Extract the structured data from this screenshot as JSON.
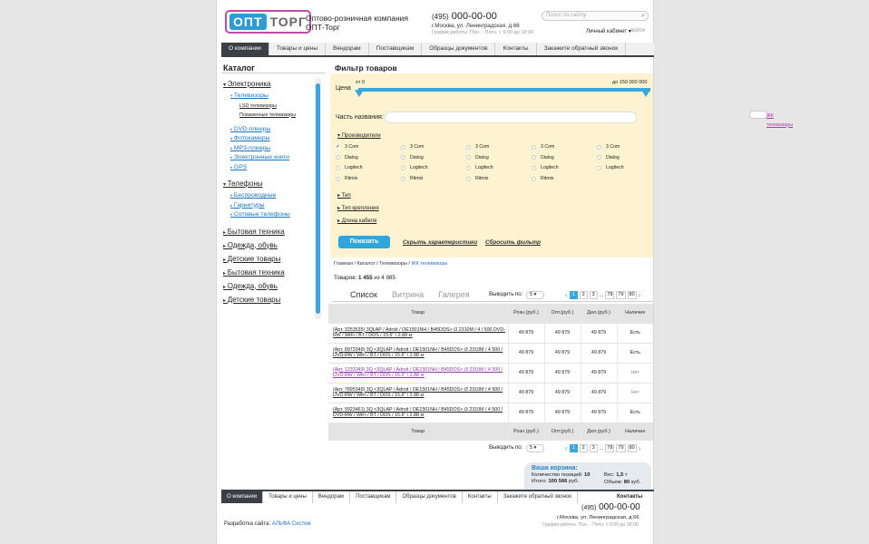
{
  "header": {
    "logo_a": "ОПТ",
    "logo_b": "ТОРГ",
    "company_line1": "Оптово-розничная компания",
    "company_line2": "ОПТ-Торг",
    "phone_code": "(495)",
    "phone_num": "000-00-00",
    "address": "г.Москва, ул. Ленинградская, д.66",
    "hours": "График работы: Пон. - Пятн. с 9:00 до 18:00",
    "search_placeholder": "Поиск по сайту",
    "cabinet": "Личный кабинет ▾",
    "login": "войти"
  },
  "nav": [
    "О компании",
    "Товары и цены",
    "Вендорам",
    "Поставщикам",
    "Образцы документов",
    "Контакты",
    "Закажите обратный звонок"
  ],
  "catalog": {
    "title": "Каталог",
    "items": [
      {
        "level": 1,
        "label": "Электроника",
        "open": true
      },
      {
        "level": 2,
        "label": "Телевизоры",
        "open": true
      },
      {
        "level": 3,
        "label": "LSD телевизоры"
      },
      {
        "level": 3,
        "label": "ЖК телевизоры",
        "selected": true
      },
      {
        "level": 3,
        "label": "Плазменные телевизоры"
      },
      {
        "gap": true
      },
      {
        "level": 2,
        "label": "DVD-плееры"
      },
      {
        "level": 2,
        "label": "Фотокамеры"
      },
      {
        "level": 2,
        "label": "MP3-плееры"
      },
      {
        "level": 2,
        "label": "Электронные книги"
      },
      {
        "level": 2,
        "label": "GPS"
      },
      {
        "gap": true
      },
      {
        "level": 1,
        "label": "Телефоны",
        "open": true
      },
      {
        "level": 2,
        "label": "Беспроводные"
      },
      {
        "level": 2,
        "label": "Гарнитуры"
      },
      {
        "level": 2,
        "label": "Сотовые телефоны"
      },
      {
        "gap": true
      },
      {
        "level": 1,
        "label": "Бытовая техника"
      },
      {
        "level": 1,
        "label": "Одежда, обувь"
      },
      {
        "level": 1,
        "label": "Детские товары"
      },
      {
        "level": 1,
        "label": "Бытовая техника"
      },
      {
        "level": 1,
        "label": "Одежда, обувь"
      },
      {
        "level": 1,
        "label": "Детские товары"
      }
    ]
  },
  "filter": {
    "title": "Фильтр товаров",
    "price_label": "Цена",
    "from": "от 0",
    "to": "до 150 000 000",
    "name_label": "Часть названия:",
    "producers": "Производители",
    "grid": [
      [
        "3 Com",
        "3 Com",
        "3 Com",
        "3 Com",
        "3 Com"
      ],
      [
        "Dialog",
        "Dialog",
        "Dialog",
        "Dialog",
        "Dialog"
      ],
      [
        "Logitech",
        "Logitech",
        "Logitech",
        "Logitech",
        "Logitech"
      ],
      [
        "Ritmix",
        "Ritmix",
        "Ritmix",
        "Ritmix"
      ]
    ],
    "checked_first": true,
    "sec_type": "Тип",
    "sec_mount": "Тип крепления",
    "sec_cable": "Длина кабеля",
    "show": "Показать",
    "hide": "Скрыть характеристики",
    "reset": "Сбросить фильтр"
  },
  "breadcrumbs": {
    "path": "Главная / Каталог / Телевизоры / ",
    "current": "ЖК телевизоры"
  },
  "count": {
    "label": "Товаров:",
    "value": "1 455",
    "of": "из",
    "total": "4 985"
  },
  "tabs": [
    "Список",
    "Витрина",
    "Галерея"
  ],
  "perpage": {
    "label": "Выводить по:",
    "value": "5"
  },
  "pages": [
    "1",
    "2",
    "3",
    "...",
    "78",
    "79",
    "80"
  ],
  "table": {
    "headers": [
      "Товар",
      "Розн.(руб.)",
      "Опт.(руб.)",
      "Дил.(руб.)",
      "Наличие"
    ],
    "rows": [
      {
        "name": "(Арт. 3253535) 3QLAP / Adroit / OE1501NH / B45DOS> i3 2310M / 4 / 500 DVD-RW / WiFi / BT / DOS / 15.6\" / 2.88 кг",
        "r": "49 879",
        "o": "49 879",
        "d": "49 879",
        "a": "Есть",
        "visited": false,
        "no": false
      },
      {
        "name": "(Арт. 8973349) 3Q <3QLAP / Adroit / OE1501NH / B45DOS> i3 2310M / 4 500 / DVD-RW / WiFi / BT / DOS / 15.6\" / 2.88 кг",
        "r": "49 879",
        "o": "49 879",
        "d": "49 879",
        "a": "Есть",
        "visited": false,
        "no": false
      },
      {
        "name": "(Арт. 1233349) 3Q <3QLAP / Adroit / OE1501NH / B45DOS> i3 2310M / 4 500 / DVD-RW / WiFi / BT / DOS / 15.6\" / 2.88 кг",
        "r": "49 879",
        "o": "49 879",
        "d": "49 879",
        "a": "Нет",
        "visited": true,
        "no": true
      },
      {
        "name": "(Арт. 7895349) 3Q <3QLAP / Adroit / OE1501NH / B45DOS> i3 2310M / 4 500 / DVD-RW / WiFi / BT / DOS / 15.6\" / 2.88 кг",
        "r": "49 879",
        "o": "49 879",
        "d": "49 879",
        "a": "Нет",
        "visited": false,
        "no": true
      },
      {
        "name": "(Арт. 9923461) 3Q <3QLAP / Adroit / OE1501NH / B45DOS> i3 2310M / 4 500 / DVD-RW / WiFi / BT / DOS / 15.6\" / 2.88 кг",
        "r": "49 879",
        "o": "49 879",
        "d": "49 879",
        "a": "Есть",
        "visited": false,
        "no": false
      }
    ]
  },
  "cart": {
    "title": "Ваша корзина:",
    "qty_label": "Количество позиций:",
    "qty": "10",
    "total_label": "Итого:",
    "total": "100 566",
    "cur": "руб.",
    "weight_label": "Вес:",
    "weight": "1,5",
    "weight_unit": "т",
    "vol_label": "Объем:",
    "vol": "80",
    "vol_unit": "куб."
  },
  "footer": {
    "contacts": "Контакты",
    "phone_code": "(495)",
    "phone_num": "000-00-00",
    "address": "г.Москва, ул. Ленинградская, д.66",
    "hours": "График работы: Пон. - Пятн. с 9:00 до 18:00",
    "dev_label": "Разработка сайта:",
    "dev_link": "АЛЬФА Систем"
  }
}
